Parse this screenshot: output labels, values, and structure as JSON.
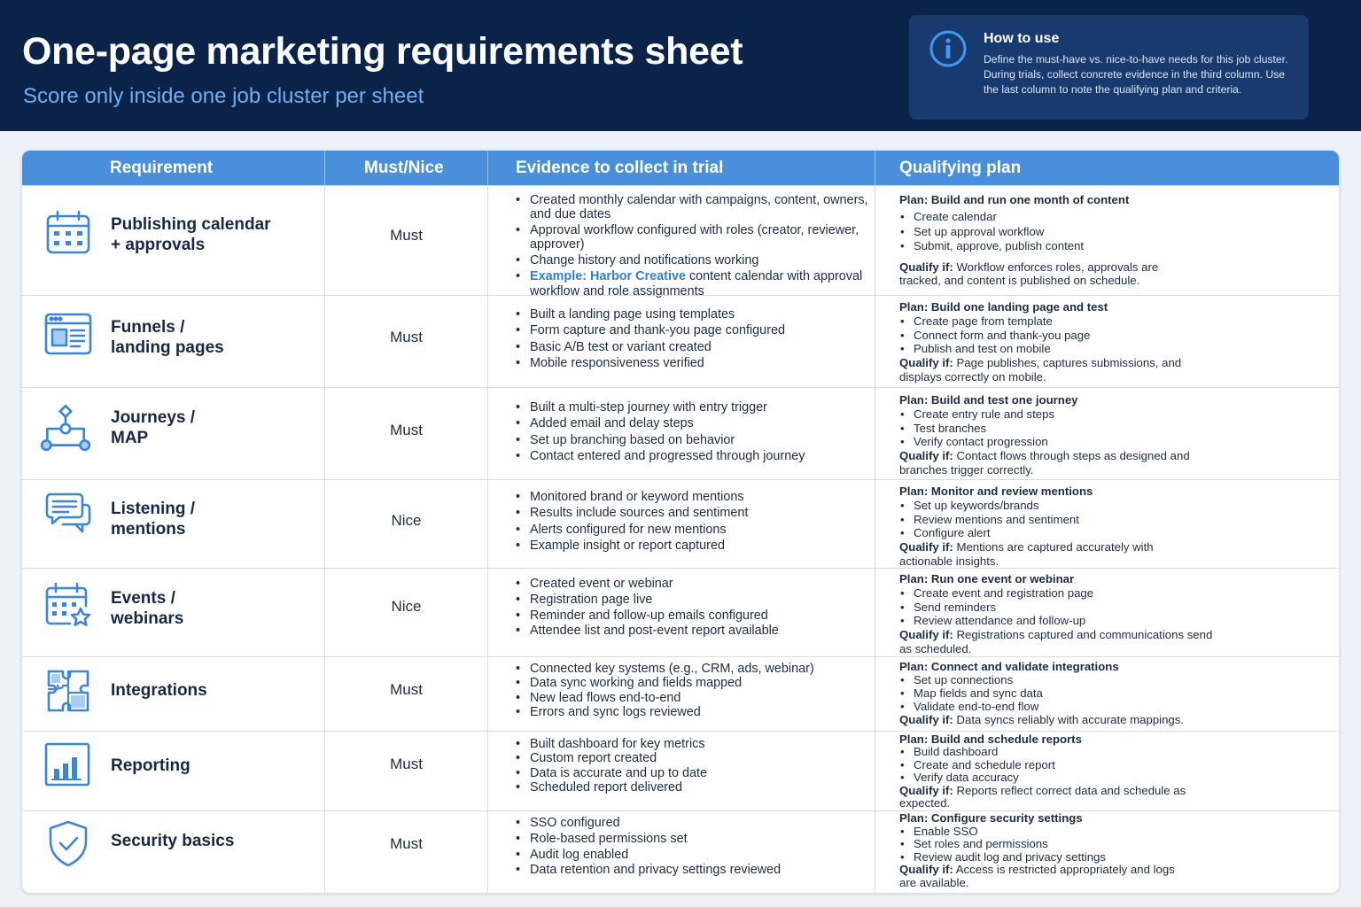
{
  "header": {
    "title": "One-page marketing requirements sheet",
    "subtitle": "Score only inside one job cluster per sheet"
  },
  "how_to_use": {
    "icon": "info-icon",
    "title": "How to use",
    "text": "Define the must-have vs. nice-to-have needs for this job cluster. During trials, collect concrete evidence in the third column. Use the last column to note the qualifying plan and criteria."
  },
  "colors": {
    "header_bg": "#0b2249",
    "accent_blue": "#4a8fdb",
    "subtitle_blue": "#6fb0f2",
    "highlight_blue": "#2f7fd4"
  },
  "table": {
    "columns": [
      "Requirement",
      "Must/Nice",
      "Evidence to collect in trial",
      "Qualifying plan"
    ],
    "qualify_label": "Qualify if:",
    "rows": [
      {
        "icon": "calendar-icon",
        "requirement": "Publishing calendar\n+ approvals",
        "must_nice": "Must",
        "evidence": [
          "Created monthly calendar with campaigns, content, owners, and due dates",
          "Approval workflow configured with roles (creator, reviewer, approver)",
          "Change history and notifications working"
        ],
        "evidence_example": {
          "label": "Example: Harbor Creative",
          "text": " content calendar with approval workflow and role assignments"
        },
        "plan_title": "Plan: Build and run one month of content",
        "plan_steps": [
          "Create calendar",
          "Set up approval workflow",
          "Submit, approve, publish content"
        ],
        "qualify": " Workflow enforces roles, approvals are tracked, and content is published on schedule."
      },
      {
        "icon": "landing-page-icon",
        "requirement": "Funnels /\nlanding pages",
        "must_nice": "Must",
        "evidence": [
          "Built a landing page using templates",
          "Form capture and thank-you page configured",
          "Basic A/B test or variant created",
          "Mobile responsiveness verified"
        ],
        "plan_title": "Plan: Build one landing page and test",
        "plan_steps": [
          "Create page from template",
          "Connect form and thank-you page",
          "Publish and test on mobile"
        ],
        "qualify": " Page publishes, captures submissions, and displays correctly on mobile."
      },
      {
        "icon": "journey-map-icon",
        "requirement": "Journeys /\nMAP",
        "must_nice": "Must",
        "evidence": [
          "Built a multi-step journey with entry trigger",
          "Added email and delay steps",
          "Set up branching based on behavior",
          "Contact entered and progressed through journey"
        ],
        "plan_title": "Plan: Build and test one journey",
        "plan_steps": [
          "Create entry rule and steps",
          "Test branches",
          "Verify contact progression"
        ],
        "qualify": " Contact flows through steps as designed and branches trigger correctly."
      },
      {
        "icon": "chat-bubbles-icon",
        "requirement": "Listening /\nmentions",
        "must_nice": "Nice",
        "evidence": [
          "Monitored brand or keyword mentions",
          "Results include sources and sentiment",
          "Alerts configured for new mentions",
          "Example insight or report captured"
        ],
        "plan_title": "Plan: Monitor and review mentions",
        "plan_steps": [
          "Set up keywords/brands",
          "Review mentions and sentiment",
          "Configure alert"
        ],
        "qualify": " Mentions are captured accurately with actionable insights."
      },
      {
        "icon": "event-calendar-star-icon",
        "requirement": "Events /\nwebinars",
        "must_nice": "Nice",
        "evidence": [
          "Created event or webinar",
          "Registration page live",
          "Reminder and follow-up emails configured",
          "Attendee list and post-event report available"
        ],
        "plan_title": "Plan: Run one event or webinar",
        "plan_steps": [
          "Create event and registration page",
          "Send reminders",
          "Review attendance and follow-up"
        ],
        "qualify": " Registrations captured and communications send as scheduled."
      },
      {
        "icon": "puzzle-icon",
        "requirement": "Integrations",
        "must_nice": "Must",
        "evidence": [
          "Connected key systems (e.g., CRM, ads, webinar)",
          "Data sync working and fields mapped",
          "New lead flows end-to-end",
          "Errors and sync logs reviewed"
        ],
        "plan_title": "Plan: Connect and validate integrations",
        "plan_steps": [
          "Set up connections",
          "Map fields and sync data",
          "Validate end-to-end flow"
        ],
        "qualify": " Data syncs reliably with accurate mappings."
      },
      {
        "icon": "bar-chart-icon",
        "requirement": "Reporting",
        "must_nice": "Must",
        "evidence": [
          "Built dashboard for key metrics",
          "Custom report created",
          "Data is accurate and up to date",
          "Scheduled report delivered"
        ],
        "plan_title": "Plan: Build and schedule reports",
        "plan_steps": [
          "Build dashboard",
          "Create and schedule report",
          "Verify data accuracy"
        ],
        "qualify": " Reports reflect correct data and schedule as expected."
      },
      {
        "icon": "shield-check-icon",
        "requirement": "Security basics",
        "must_nice": "Must",
        "evidence": [
          "SSO configured",
          "Role-based permissions set",
          "Audit log enabled",
          "Data retention and privacy settings reviewed"
        ],
        "plan_title": "Plan: Configure security settings",
        "plan_steps": [
          "Enable SSO",
          "Set roles and permissions",
          "Review audit log and privacy settings"
        ],
        "qualify": " Access is restricted appropriately and logs are available."
      }
    ]
  }
}
